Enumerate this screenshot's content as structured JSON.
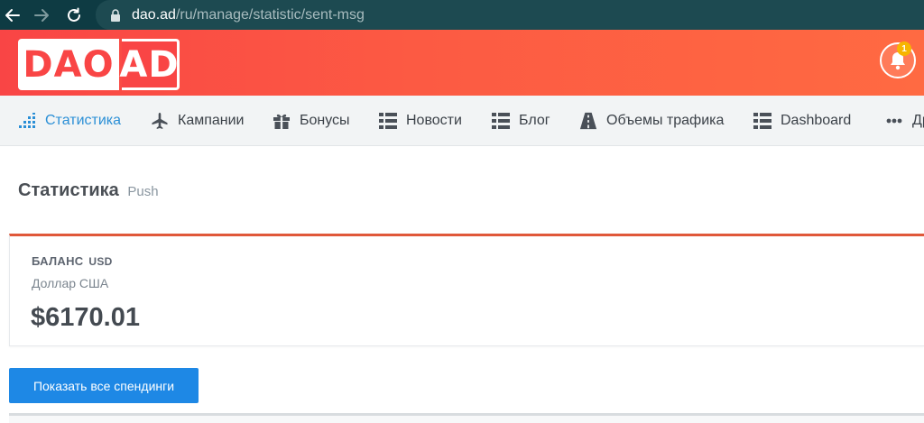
{
  "browser": {
    "url_domain": "dao.ad",
    "url_path": "/ru/manage/statistic/sent-msg"
  },
  "header": {
    "logo_left": "DAO",
    "logo_right": "AD",
    "notification_count": "1"
  },
  "menu": {
    "items": [
      {
        "label": "Статистика",
        "icon": "bar-chart-icon",
        "active": true
      },
      {
        "label": "Кампании",
        "icon": "airplane-icon"
      },
      {
        "label": "Бонусы",
        "icon": "gift-icon"
      },
      {
        "label": "Новости",
        "icon": "list-icon"
      },
      {
        "label": "Блог",
        "icon": "list-icon"
      },
      {
        "label": "Объемы трафика",
        "icon": "road-icon"
      },
      {
        "label": "Dashboard",
        "icon": "list-icon"
      },
      {
        "label": "Др",
        "icon": "more-dots-icon"
      }
    ]
  },
  "page": {
    "title": "Статистика",
    "subtitle": "Push"
  },
  "balance": {
    "label": "БАЛАНС",
    "currency": "USD",
    "currency_name": "Доллар США",
    "amount": "$6170.01"
  },
  "actions": {
    "show_all_spendings": "Показать все спендинги"
  },
  "colors": {
    "browser_bar": "#0e3b43",
    "header_gradient_start": "#f94545",
    "header_gradient_end": "#ff6a42",
    "active_menu": "#2b8fd6",
    "primary_button": "#1e88e5",
    "card_accent": "#e0583a",
    "badge": "#f7b500"
  }
}
